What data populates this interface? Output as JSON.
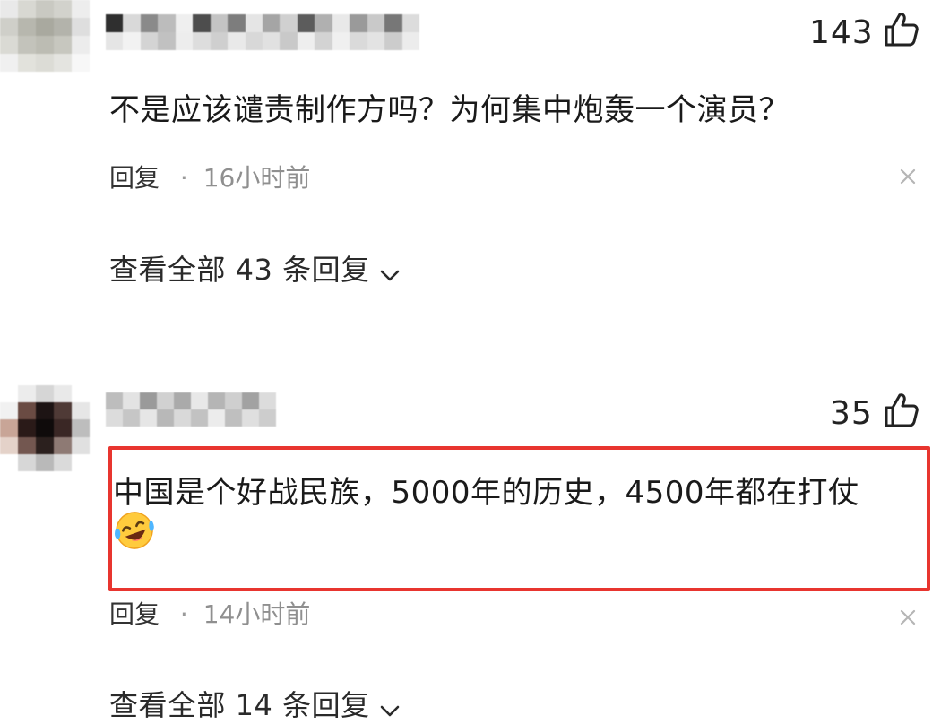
{
  "comments": [
    {
      "like_count": "143",
      "text": "不是应该谴责制作方吗？为何集中炮轰一个演员？",
      "reply_label": "回复",
      "separator": "·",
      "time": "16小时前",
      "view_replies": "查看全部 43 条回复"
    },
    {
      "like_count": "35",
      "text": "中国是个好战民族，5000年的历史，4500年都在打仗",
      "emoji": "laughing-crying-emoji",
      "reply_label": "回复",
      "separator": "·",
      "time": "14小时前",
      "view_replies": "查看全部 14 条回复"
    }
  ],
  "icons": {
    "like": "thumbs-up-icon",
    "close": "close-icon",
    "expand": "chevron-down-icon"
  },
  "colors": {
    "highlight_border": "#e8352f",
    "time_text": "#8f8f8f"
  }
}
